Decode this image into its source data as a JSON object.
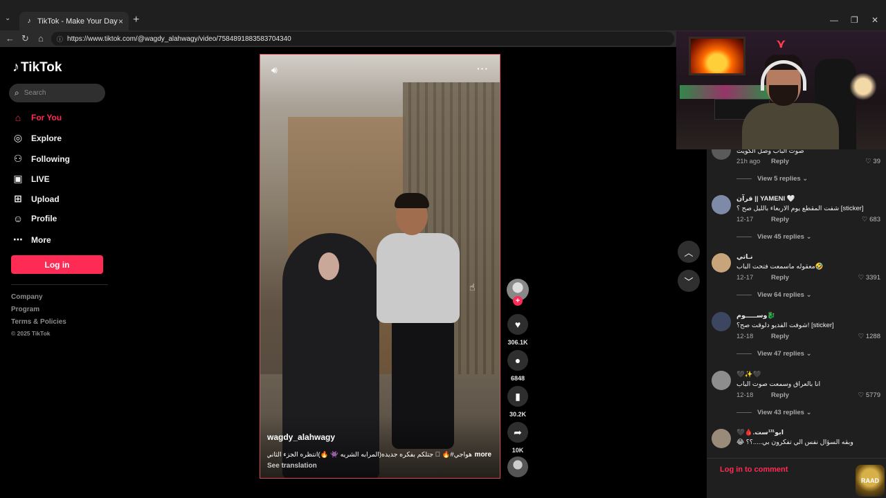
{
  "browser": {
    "tab_title": "TikTok - Make Your Day",
    "url": "https://www.tiktok.com/@wagdy_alahwagy/video/7584891883583704340",
    "new_tab": "+",
    "close_tab": "×",
    "win_min": "—",
    "win_max": "❐",
    "win_close": "✕"
  },
  "sidebar": {
    "brand": "TikTok",
    "search_placeholder": "Search",
    "items": [
      {
        "label": "For You",
        "icon": "home-icon"
      },
      {
        "label": "Explore",
        "icon": "compass-icon"
      },
      {
        "label": "Following",
        "icon": "following-icon"
      },
      {
        "label": "LIVE",
        "icon": "live-icon"
      },
      {
        "label": "Upload",
        "icon": "upload-icon"
      },
      {
        "label": "Profile",
        "icon": "profile-icon"
      },
      {
        "label": "More",
        "icon": "more-dots-icon"
      }
    ],
    "login": "Log in",
    "footer": [
      "Company",
      "Program",
      "Terms & Policies",
      "© 2025 TikTok"
    ]
  },
  "video": {
    "username": "wagdy_alahwagy",
    "caption": "هواجي#🔥 🏾 جتلكم بفكره جديده(المرابه الشريه 👾 🔥)انتظره الجزء الثاني...",
    "caption_more": "more",
    "see_translation": "See translation"
  },
  "actions": {
    "likes": "306.1K",
    "comments": "6848",
    "saves": "30.2K",
    "shares": "10K"
  },
  "comments": [
    {
      "name": "",
      "text": "صوت الباب وصل الكويت",
      "date": "21h ago",
      "reply": "Reply",
      "likes": "39",
      "replies": "View 5 replies",
      "avatar_color": "#5a5a5a"
    },
    {
      "name": "قرآن || YAMENI 🤍",
      "text": "شفت المقطع يوم الاربعاء بالليل صح ؟ [sticker]",
      "date": "12-17",
      "reply": "Reply",
      "likes": "683",
      "replies": "View 45 replies",
      "avatar_color": "#7e8ba8"
    },
    {
      "name": "نـاتي",
      "text": "معقوله ماسمعت فتحت الباب🤣",
      "date": "12-17",
      "reply": "Reply",
      "likes": "3391",
      "replies": "View 64 replies",
      "avatar_color": "#c7a47a"
    },
    {
      "name": "وســـــوم🐉",
      "text": "شوفت الفديو دلوقت صح؟! [sticker]",
      "date": "12-18",
      "reply": "Reply",
      "likes": "1288",
      "replies": "View 47 replies",
      "avatar_color": "#3c4660"
    },
    {
      "name": "🖤✨🖤",
      "text": "انا بالعراق وسمعت صوت الباب",
      "date": "12-18",
      "reply": "Reply",
      "likes": "5779",
      "replies": "View 43 replies",
      "avatar_color": "#8d8d8d"
    },
    {
      "name": "🖤🩸.ابو¹³¹ست",
      "text": "😂 وبقه السؤال نفس الي تفكرون بي.....؟؟",
      "date": "",
      "reply": "",
      "likes": "",
      "replies": "",
      "avatar_color": "#9a8a7a"
    }
  ],
  "comment_login": "Log in to comment",
  "badge_text": "RAAD",
  "colors": {
    "accent": "#fe2c55",
    "panel": "#1f1f1f"
  }
}
